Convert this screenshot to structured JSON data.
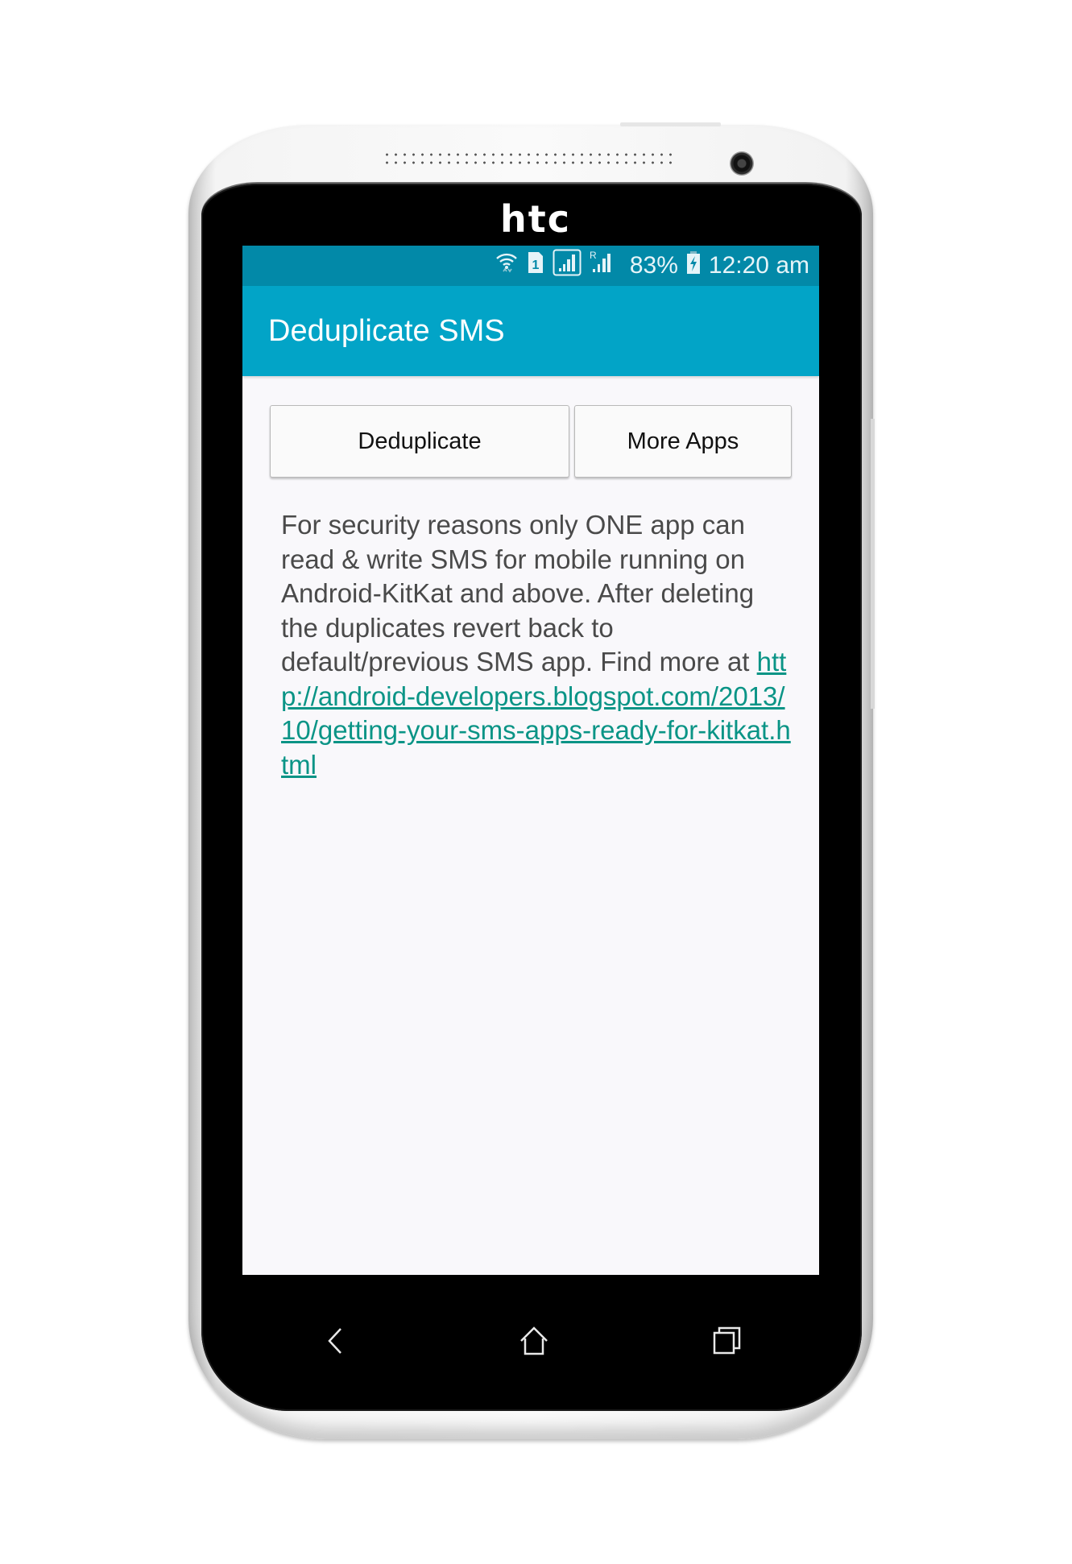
{
  "device": {
    "brand": "htc"
  },
  "status_bar": {
    "icons": [
      "wifi-icon",
      "sim-1-icon",
      "signal-icon",
      "roaming-signal-icon",
      "battery-charging-icon"
    ],
    "roaming_label": "R",
    "sim_label": "1",
    "battery_percent": "83%",
    "time": "12:20 am",
    "color": "#0289a8"
  },
  "app_bar": {
    "title": "Deduplicate SMS",
    "color": "#02a4c7"
  },
  "buttons": {
    "deduplicate": "Deduplicate",
    "more_apps": "More Apps"
  },
  "message": {
    "text": "For security reasons only ONE app can read & write SMS for mobile running on Android-KitKat and above. After deleting the duplicates revert back to default/previous SMS app. Find more at ",
    "link_text": "http://android-developers.blogspot.com/2013/10/getting-your-sms-apps-ready-for-kitkat.html",
    "link_color": "#0a9486"
  },
  "nav_bar": {
    "back": "back-icon",
    "home": "home-icon",
    "recents": "recents-icon"
  }
}
